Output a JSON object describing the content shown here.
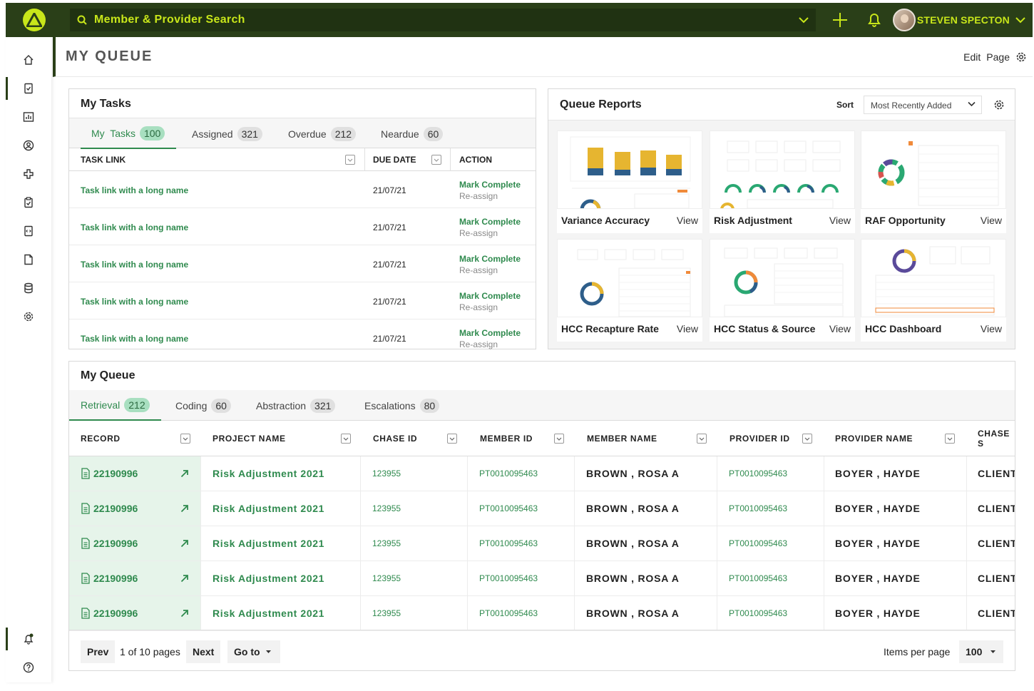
{
  "topbar": {
    "search_label": "Member & Provider Search",
    "user_name": "STEVEN SPECTON"
  },
  "page": {
    "title": "MY QUEUE",
    "edit_label": "Edit",
    "page_label": "Page"
  },
  "tasks": {
    "title": "My Tasks",
    "tabs": [
      {
        "label": "My  Tasks",
        "count": "100"
      },
      {
        "label": "Assigned",
        "count": "321"
      },
      {
        "label": "Overdue",
        "count": "212"
      },
      {
        "label": "Neardue",
        "count": "60"
      }
    ],
    "columns": {
      "task_link": "TASK LINK",
      "due_date": "DUE DATE",
      "action": "ACTION"
    },
    "rows": [
      {
        "link": "Task link with a long name",
        "date": "21/07/21",
        "complete": "Mark Complete",
        "reassign": "Re-assign"
      },
      {
        "link": "Task link with a long name",
        "date": "21/07/21",
        "complete": "Mark Complete",
        "reassign": "Re-assign"
      },
      {
        "link": "Task link with a long name",
        "date": "21/07/21",
        "complete": "Mark Complete",
        "reassign": "Re-assign"
      },
      {
        "link": "Task link with a long name",
        "date": "21/07/21",
        "complete": "Mark Complete",
        "reassign": "Re-assign"
      },
      {
        "link": "Task link with a long name",
        "date": "21/07/21",
        "complete": "Mark Complete",
        "reassign": "Re-assign"
      }
    ]
  },
  "reports": {
    "title": "Queue Reports",
    "sort_label": "Sort",
    "sort_value": "Most Recently Added",
    "tiles": [
      {
        "name": "Variance Accuracy",
        "view": "View"
      },
      {
        "name": "Risk Adjustment",
        "view": "View"
      },
      {
        "name": "RAF Opportunity",
        "view": "View"
      },
      {
        "name": "HCC Recapture Rate",
        "view": "View"
      },
      {
        "name": "HCC Status & Source",
        "view": "View"
      },
      {
        "name": "HCC Dashboard",
        "view": "View"
      }
    ]
  },
  "queue": {
    "title": "My Queue",
    "tabs": [
      {
        "label": "Retrieval",
        "count": "212"
      },
      {
        "label": "Coding",
        "count": "60"
      },
      {
        "label": "Abstraction",
        "count": "321"
      },
      {
        "label": "Escalations",
        "count": "80"
      }
    ],
    "columns": {
      "record": "RECORD",
      "project_name": "PROJECT  NAME",
      "chase_id": "CHASE  ID",
      "member_id": "MEMBER  ID",
      "member_name": "MEMBER  NAME",
      "provider_id": "PROVIDER  ID",
      "provider_name": "PROVIDER  NAME",
      "chase_status": "CHASE  S"
    },
    "rows": [
      {
        "record": "22190996",
        "project": "Risk  Adjustment  2021",
        "chase_id": "123955",
        "member_id": "PT0010095463",
        "member_name": "BROWN ,  ROSA  A",
        "provider_id": "PT0010095463",
        "provider_name": "BOYER ,  HAYDE",
        "chase_status": "CLIENT"
      },
      {
        "record": "22190996",
        "project": "Risk  Adjustment  2021",
        "chase_id": "123955",
        "member_id": "PT0010095463",
        "member_name": "BROWN ,  ROSA  A",
        "provider_id": "PT0010095463",
        "provider_name": "BOYER ,  HAYDE",
        "chase_status": "CLIENT"
      },
      {
        "record": "22190996",
        "project": "Risk  Adjustment  2021",
        "chase_id": "123955",
        "member_id": "PT0010095463",
        "member_name": "BROWN ,  ROSA  A",
        "provider_id": "PT0010095463",
        "provider_name": "BOYER ,  HAYDE",
        "chase_status": "CLIENT"
      },
      {
        "record": "22190996",
        "project": "Risk  Adjustment  2021",
        "chase_id": "123955",
        "member_id": "PT0010095463",
        "member_name": "BROWN ,  ROSA  A",
        "provider_id": "PT0010095463",
        "provider_name": "BOYER ,  HAYDE",
        "chase_status": "CLIENT"
      },
      {
        "record": "22190996",
        "project": "Risk  Adjustment  2021",
        "chase_id": "123955",
        "member_id": "PT0010095463",
        "member_name": "BROWN ,  ROSA  A",
        "provider_id": "PT0010095463",
        "provider_name": "BOYER ,  HAYDE",
        "chase_status": "CLIENT"
      }
    ],
    "pager": {
      "prev": "Prev",
      "page_info": "1 of 10 pages",
      "next": "Next",
      "goto": "Go to",
      "items_label": "Items per page",
      "items_value": "100"
    }
  },
  "sidebar": {
    "icons": [
      "home-icon",
      "task-icon",
      "report-icon",
      "user-icon",
      "medical-icon",
      "clipboard-icon",
      "document-code-icon",
      "file-icon",
      "database-icon",
      "settings-icon",
      "notification-icon",
      "help-icon"
    ]
  },
  "colors": {
    "brand_dark": "#2a3f18",
    "accent_lime": "#c8e61a",
    "link_green": "#2f8a4e",
    "record_bg": "#e6f4ea"
  }
}
